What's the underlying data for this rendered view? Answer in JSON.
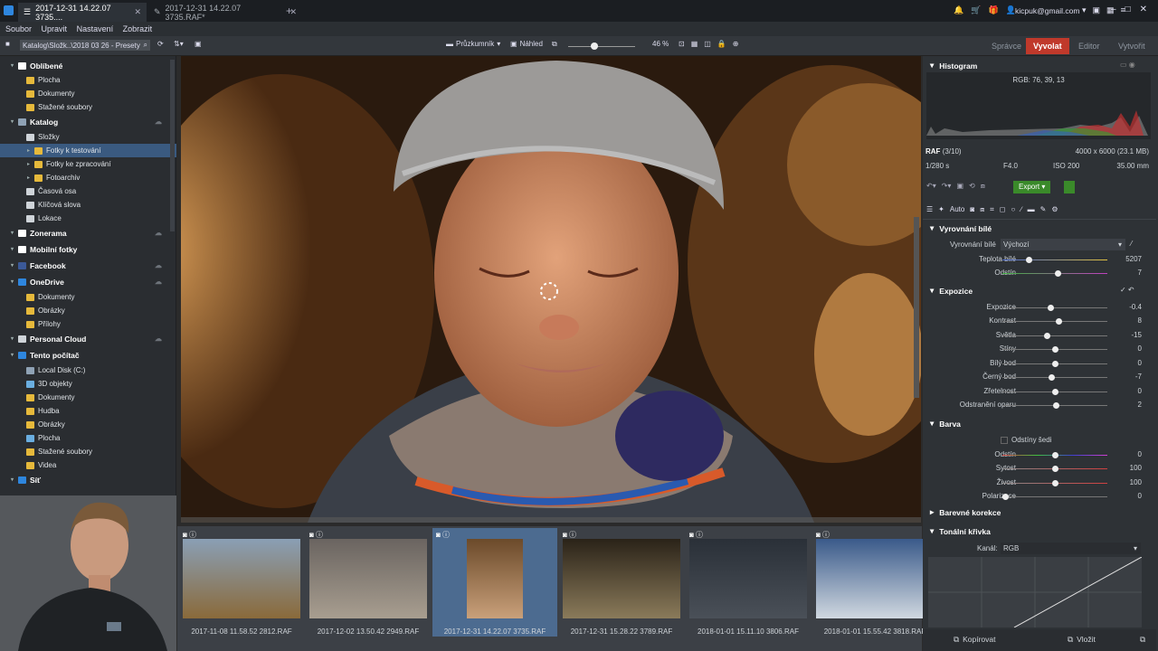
{
  "tabs": [
    {
      "label": "2017-12-31 14.22.07 3735...."
    },
    {
      "label": "2017-12-31 14.22.07 3735.RAF*"
    }
  ],
  "user": {
    "email": "kicpuk@gmail.com"
  },
  "menu": [
    "Soubor",
    "Upravit",
    "Nastavení",
    "Zobrazit"
  ],
  "toolbar": {
    "path": "Katalog\\Složk..\\2018 03 26 - Presety",
    "explorer": "Průzkumník",
    "preview": "Náhled",
    "zoom": "46 %"
  },
  "modes": [
    "Správce",
    "Vyvolat",
    "Editor",
    "Vytvořit"
  ],
  "tree": [
    {
      "label": "Oblíbené",
      "level": 0,
      "hdr": true,
      "icon": "star-icon",
      "color": "#ffffff"
    },
    {
      "label": "Plocha",
      "level": 1,
      "icon": "folder-icon",
      "color": "#e6b93b"
    },
    {
      "label": "Dokumenty",
      "level": 1,
      "icon": "folder-icon",
      "color": "#e6b93b"
    },
    {
      "label": "Stažené soubory",
      "level": 1,
      "icon": "folder-icon",
      "color": "#e6b93b"
    },
    {
      "label": "Katalog",
      "level": 0,
      "hdr": true,
      "icon": "catalog-icon",
      "color": "#8fa2b5"
    },
    {
      "label": "Složky",
      "level": 1,
      "icon": "folder-icon",
      "color": "#cfd4d9"
    },
    {
      "label": "Fotky k testování",
      "level": 2,
      "sel": true,
      "icon": "folder-icon",
      "color": "#e6b93b"
    },
    {
      "label": "Fotky ke zpracování",
      "level": 2,
      "icon": "folder-icon",
      "color": "#e6b93b"
    },
    {
      "label": "Fotoarchiv",
      "level": 2,
      "icon": "folder-icon",
      "color": "#e6b93b"
    },
    {
      "label": "Časová osa",
      "level": 1,
      "icon": "calendar-icon",
      "color": "#cfd4d9"
    },
    {
      "label": "Klíčová slova",
      "level": 1,
      "icon": "tag-icon",
      "color": "#cfd4d9"
    },
    {
      "label": "Lokace",
      "level": 1,
      "icon": "pin-icon",
      "color": "#cfd4d9"
    },
    {
      "label": "Zonerama",
      "level": 0,
      "hdr": true,
      "icon": "zonerama-icon",
      "color": "#ffffff"
    },
    {
      "label": "Mobilní fotky",
      "level": 0,
      "hdr": true,
      "icon": "phone-icon",
      "color": "#ffffff"
    },
    {
      "label": "Facebook",
      "level": 0,
      "hdr": true,
      "icon": "facebook-icon",
      "color": "#3b5998"
    },
    {
      "label": "OneDrive",
      "level": 0,
      "hdr": true,
      "icon": "cloud-icon",
      "color": "#2e86de"
    },
    {
      "label": "Dokumenty",
      "level": 1,
      "icon": "folder-icon",
      "color": "#e6b93b"
    },
    {
      "label": "Obrázky",
      "level": 1,
      "icon": "folder-icon",
      "color": "#e6b93b"
    },
    {
      "label": "Přílohy",
      "level": 1,
      "icon": "folder-icon",
      "color": "#e6b93b"
    },
    {
      "label": "Personal Cloud",
      "level": 0,
      "hdr": true,
      "icon": "server-icon",
      "color": "#cfd4d9"
    },
    {
      "label": "Tento počítač",
      "level": 0,
      "hdr": true,
      "icon": "computer-icon",
      "color": "#2e86de"
    },
    {
      "label": "Local Disk (C:)",
      "level": 1,
      "icon": "disk-icon",
      "color": "#8fa2b5"
    },
    {
      "label": "3D objekty",
      "level": 1,
      "icon": "folder-icon",
      "color": "#6aaee0"
    },
    {
      "label": "Dokumenty",
      "level": 1,
      "icon": "folder-icon",
      "color": "#e6b93b"
    },
    {
      "label": "Hudba",
      "level": 1,
      "icon": "folder-icon",
      "color": "#e6b93b"
    },
    {
      "label": "Obrázky",
      "level": 1,
      "icon": "folder-icon",
      "color": "#e6b93b"
    },
    {
      "label": "Plocha",
      "level": 1,
      "icon": "folder-icon",
      "color": "#6aaee0"
    },
    {
      "label": "Stažené soubory",
      "level": 1,
      "icon": "folder-icon",
      "color": "#e6b93b"
    },
    {
      "label": "Videa",
      "level": 1,
      "icon": "folder-icon",
      "color": "#e6b93b"
    },
    {
      "label": "Síť",
      "level": 0,
      "hdr": true,
      "icon": "network-icon",
      "color": "#2e86de"
    }
  ],
  "thumbs": [
    {
      "caption": "2017-11-08 11.58.52 2812.RAF",
      "c1": "#8a9fb5",
      "c2": "#8a6a3a"
    },
    {
      "caption": "2017-12-02 13.50.42 2949.RAF",
      "c1": "#6a6460",
      "c2": "#a89e90"
    },
    {
      "caption": "2017-12-31 14.22.07 3735.RAF",
      "c1": "#6b4a2a",
      "c2": "#c9a07a",
      "sel": true
    },
    {
      "caption": "2017-12-31 15.28.22 3789.RAF",
      "c1": "#2a2218",
      "c2": "#8a7a5a"
    },
    {
      "caption": "2018-01-01 15.11.10 3806.RAF",
      "c1": "#2a3038",
      "c2": "#4a5058"
    },
    {
      "caption": "2018-01-01 15.55.42 3818.RAF",
      "c1": "#3a5a8a",
      "c2": "#d0d8e0"
    }
  ],
  "histogram": {
    "title": "Histogram",
    "rgb": "RGB: 76, 39, 13"
  },
  "info": {
    "format": "RAF",
    "index": "(3/10)",
    "dims": "4000 x 6000 (23.1 MB)",
    "shutter": "1/280 s",
    "aperture": "F4.0",
    "iso": "ISO 200",
    "focal": "35.00 mm"
  },
  "actions": {
    "export": "Export",
    "auto": "Auto"
  },
  "wb": {
    "title": "Vyrovnání bílé",
    "preset_label": "Vyrovnání bílé",
    "preset": "Výchozí",
    "rows": [
      {
        "label": "Teplota bílé",
        "value": "5207",
        "level": 0.25
      },
      {
        "label": "Odstín",
        "value": "7",
        "level": 0.53
      }
    ]
  },
  "exposure": {
    "title": "Expozice",
    "rows": [
      {
        "label": "Expozice",
        "value": "-0.4",
        "level": 0.46
      },
      {
        "label": "Kontrast",
        "value": "8",
        "level": 0.54
      },
      {
        "label": "Světla",
        "value": "-15",
        "level": 0.43
      },
      {
        "label": "Stíny",
        "value": "0",
        "level": 0.5
      },
      {
        "label": "Bílý bod",
        "value": "0",
        "level": 0.5
      },
      {
        "label": "Černý bod",
        "value": "-7",
        "level": 0.47
      },
      {
        "label": "Zřetelnost",
        "value": "0",
        "level": 0.5
      },
      {
        "label": "Odstranění oparu",
        "value": "2",
        "level": 0.51
      }
    ]
  },
  "color": {
    "title": "Barva",
    "gray_label": "Odstíny šedi",
    "rows": [
      {
        "label": "Odstín",
        "value": "0",
        "level": 0.5
      },
      {
        "label": "Sytost",
        "value": "100",
        "level": 0.5
      },
      {
        "label": "Živost",
        "value": "100",
        "level": 0.5
      },
      {
        "label": "Polarizace",
        "value": "0",
        "level": 0.03
      }
    ]
  },
  "color_correction": "Barevné korekce",
  "curve": {
    "title": "Tonální křivka",
    "channel_label": "Kanál:",
    "channel": "RGB"
  },
  "bottom": {
    "copy": "Kopírovat",
    "paste": "Vložit"
  }
}
